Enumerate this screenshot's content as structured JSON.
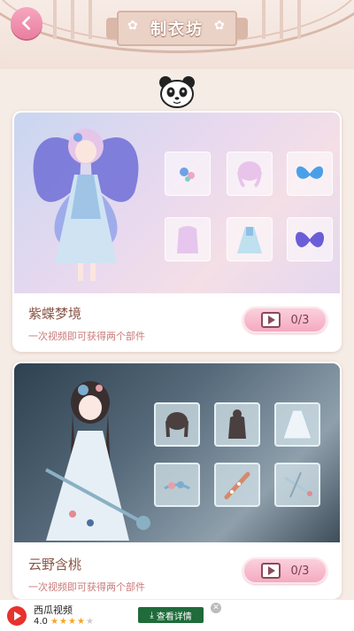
{
  "header": {
    "title": "制衣坊"
  },
  "cards": [
    {
      "name": "紫蝶梦境",
      "subtitle": "一次视频即可获得两个部件",
      "progress": "0/3"
    },
    {
      "name": "云野含桃",
      "subtitle": "一次视频即可获得两个部件",
      "progress": "0/3"
    }
  ],
  "ad": {
    "app_name": "西瓜视频",
    "rating": "4.0",
    "stars_filled": 4,
    "button_label": "查看详情",
    "close_label": "✕"
  },
  "colors": {
    "accent_pink": "#f4aac0",
    "back_button": "#ea7ea0",
    "title_text": "#8a5546",
    "subtitle_text": "#c97a7a"
  },
  "icons": [
    "back-arrow-icon",
    "panda-icon",
    "play-video-icon",
    "flower-icon",
    "download-icon",
    "close-icon"
  ]
}
